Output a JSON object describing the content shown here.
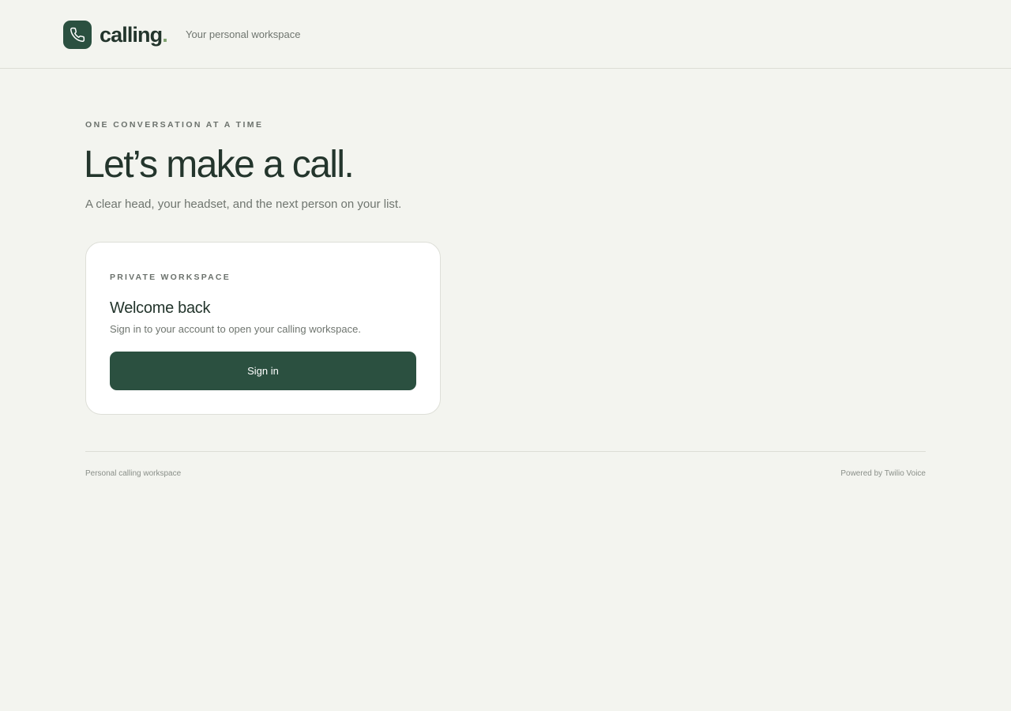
{
  "header": {
    "brand_name": "calling",
    "brand_dot": ".",
    "tagline": "Your personal workspace",
    "logo_icon": "phone-icon"
  },
  "hero": {
    "eyebrow": "ONE CONVERSATION AT A TIME",
    "title": "Let’s make a call.",
    "subtitle": "A clear head, your headset, and the next person on your list."
  },
  "signin_card": {
    "eyebrow": "PRIVATE WORKSPACE",
    "title": "Welcome back",
    "description": "Sign in to your account to open your calling workspace.",
    "button_label": "Sign in"
  },
  "footer": {
    "left_text": "Personal calling workspace",
    "right_text": "Powered by Twilio Voice"
  },
  "colors": {
    "background": "#f3f4ef",
    "brand_green": "#2b5040",
    "brand_accent": "#7fa26f",
    "text_primary": "#23352c",
    "text_muted": "#6f756f"
  }
}
